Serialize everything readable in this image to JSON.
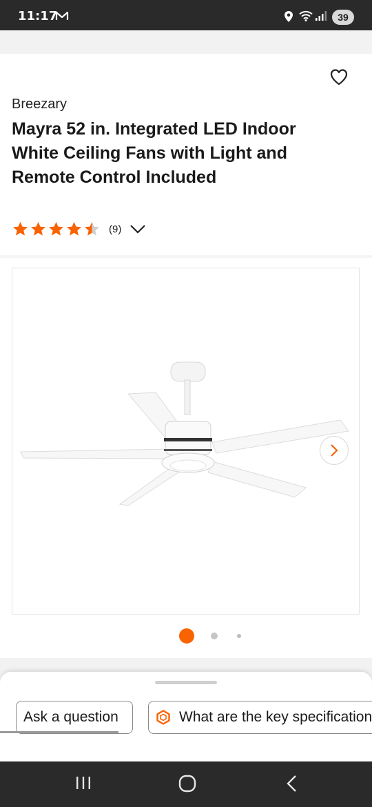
{
  "status": {
    "time": "11:17",
    "battery": "39",
    "icons": [
      "mail-icon",
      "location-icon",
      "wifi-icon",
      "signal-icon"
    ]
  },
  "product": {
    "brand": "Breezary",
    "title": "Mayra 52 in. Integrated LED Indoor White Ceiling Fans with Light and Remote Control Included",
    "rating": 4.5,
    "review_count": "(9)",
    "image_index": 1,
    "image_count": 3
  },
  "sheet": {
    "ask_label": "Ask a question",
    "spec_label": "What are the key specifications?"
  },
  "colors": {
    "accent": "#f96302",
    "status_bar": "#2a2a2a"
  }
}
